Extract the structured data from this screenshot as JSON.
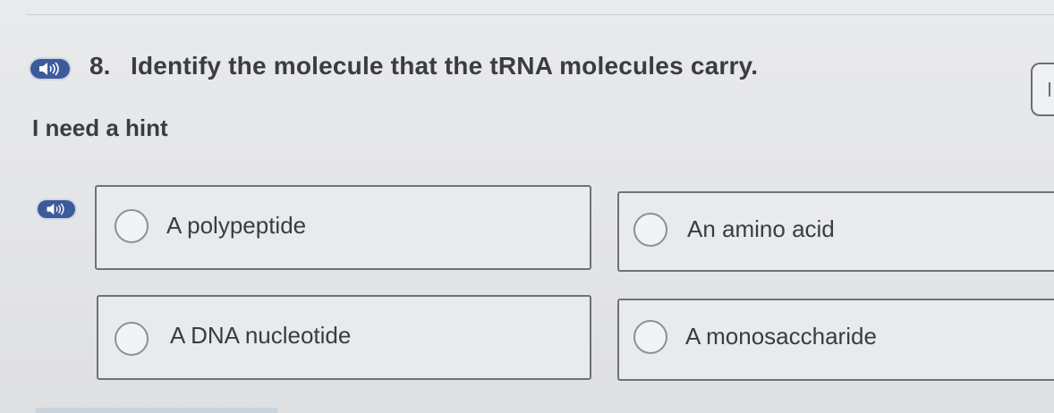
{
  "question": {
    "number": "8.",
    "text": "Identify the molecule that the tRNA molecules carry."
  },
  "hint_link": "I need a hint",
  "icons": {
    "question_audio": "speaker-icon",
    "options_audio": "speaker-icon"
  },
  "options": [
    {
      "label": "A polypeptide"
    },
    {
      "label": "An amino acid"
    },
    {
      "label": "A DNA nucleotide"
    },
    {
      "label": "A monosaccharide"
    }
  ],
  "colors": {
    "speaker": "#3d5a9a",
    "text": "#3a3c44",
    "border": "#6e7178"
  }
}
